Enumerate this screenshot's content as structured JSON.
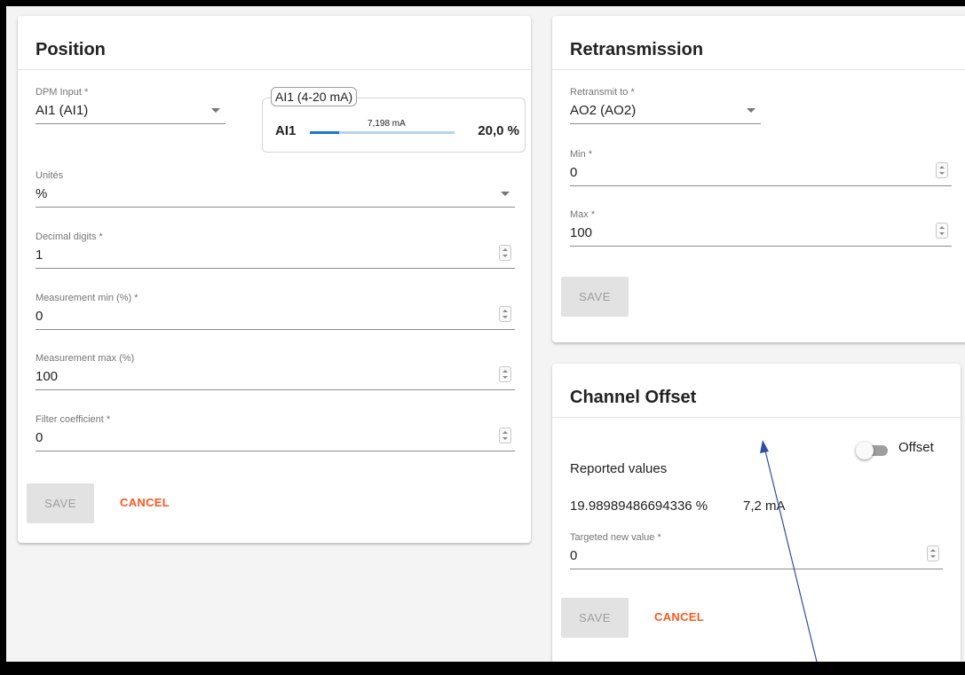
{
  "position_card": {
    "title": "Position",
    "dpm_input": {
      "label": "DPM Input *",
      "value": "AI1 (AI1)"
    },
    "ai_panel": {
      "legend": "AI1 (4-20 mA)",
      "name": "AI1",
      "current": "7,198 mA",
      "percent": "20,0 %",
      "level": 0.2
    },
    "units": {
      "label": "Unités",
      "value": "%"
    },
    "decimal_digits": {
      "label": "Decimal digits *",
      "value": "1"
    },
    "measurement_min": {
      "label": "Measurement min (%) *",
      "value": "0"
    },
    "measurement_max": {
      "label": "Measurement max (%)",
      "value": "100"
    },
    "filter_coefficient": {
      "label": "Filter coefficient *",
      "value": "0"
    },
    "save_label": "SAVE",
    "cancel_label": "CANCEL"
  },
  "retransmission_card": {
    "title": "Retransmission",
    "retransmit_to": {
      "label": "Retransmit to *",
      "value": "AO2 (AO2)"
    },
    "min": {
      "label": "Min *",
      "value": "0"
    },
    "max": {
      "label": "Max *",
      "value": "100"
    },
    "save_label": "SAVE"
  },
  "channel_offset_card": {
    "title": "Channel Offset",
    "offset_toggle": {
      "label": "Offset",
      "on": false
    },
    "reported_values_label": "Reported values",
    "reported_percent": "19.98989486694336 %",
    "reported_current": "7,2 mA",
    "targeted_new_value": {
      "label": "Targeted new value *",
      "value": "0"
    },
    "save_label": "SAVE",
    "cancel_label": "CANCEL"
  },
  "colors": {
    "accent": "#ff5722",
    "bar_fill": "#1976d2",
    "bar_track": "#b3d6ee",
    "annotation_arrow": "#2f4f9f"
  }
}
